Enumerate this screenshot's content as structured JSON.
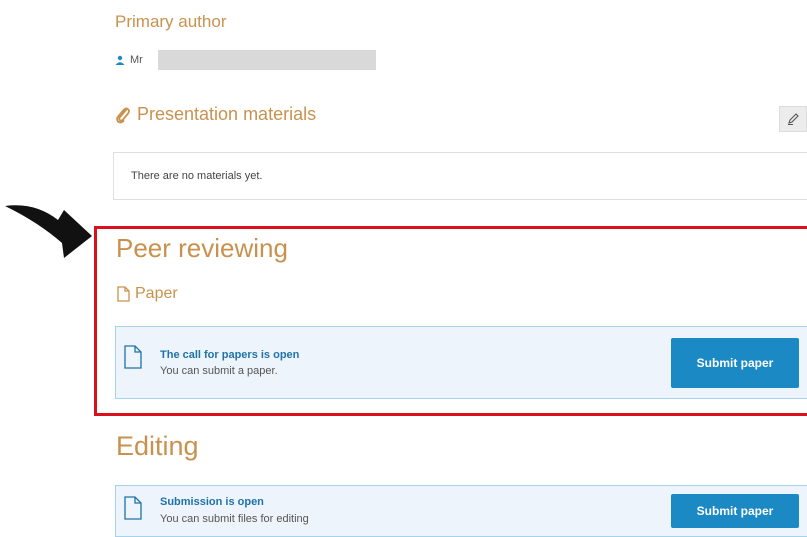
{
  "primary_author": {
    "heading": "Primary author",
    "name_prefix": "Mr"
  },
  "presentation_materials": {
    "heading": "Presentation materials",
    "empty_text": "There are no materials yet."
  },
  "peer_reviewing": {
    "heading": "Peer reviewing",
    "paper_label": "Paper",
    "notice": {
      "title": "The call for papers is open",
      "text": "You can submit a paper.",
      "button_label": "Submit paper"
    }
  },
  "editing": {
    "heading": "Editing",
    "notice": {
      "title": "Submission is open",
      "text": "You can submit files for editing",
      "button_label": "Submit paper"
    }
  },
  "colors": {
    "heading": "#c8924e",
    "highlight_border": "#d8111b",
    "button": "#1b8ac4",
    "notice_bg": "#eef4fb"
  },
  "icons": [
    "user-icon",
    "paperclip-icon",
    "pencil-icon",
    "document-icon",
    "arrow-icon"
  ]
}
